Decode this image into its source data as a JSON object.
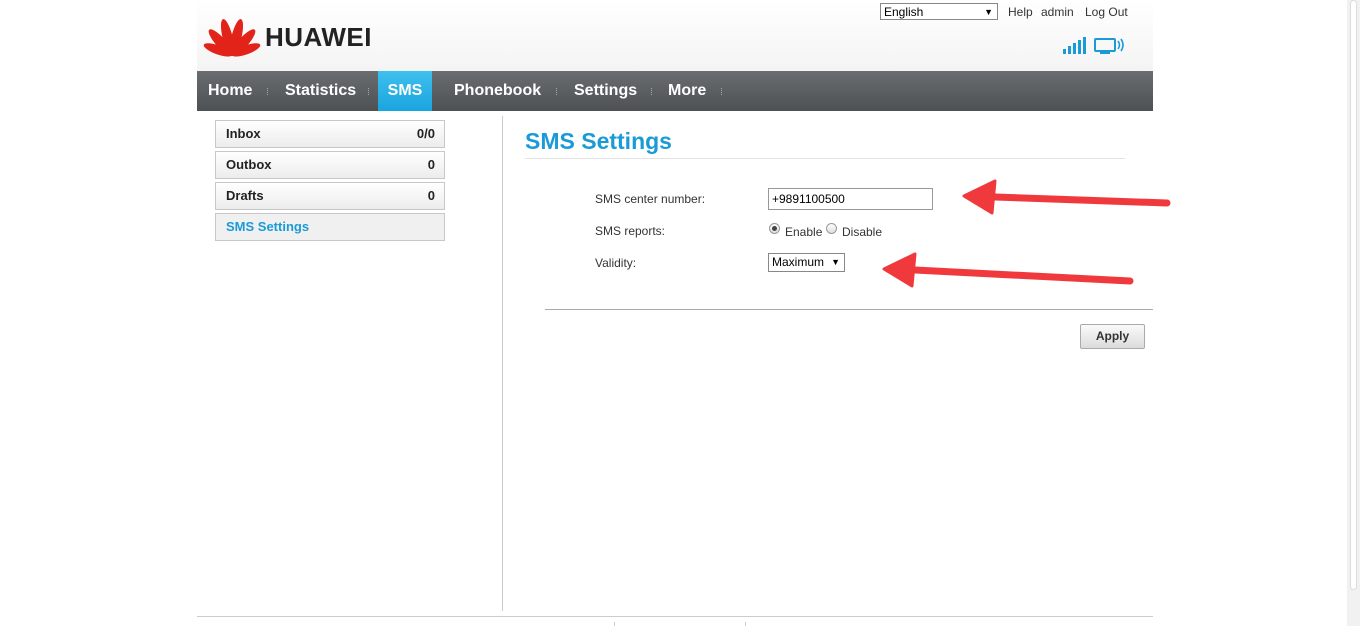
{
  "header": {
    "brand": "HUAWEI",
    "language": "English",
    "links": {
      "help": "Help",
      "user": "admin",
      "logout": "Log Out"
    },
    "colors": {
      "brand_red": "#e2231a",
      "status_blue": "#1a9bd7"
    }
  },
  "nav": {
    "items": [
      {
        "label": "Home"
      },
      {
        "label": "Statistics"
      },
      {
        "label": "SMS",
        "active": true
      },
      {
        "label": "Phonebook"
      },
      {
        "label": "Settings"
      },
      {
        "label": "More"
      }
    ]
  },
  "sidebar": {
    "items": [
      {
        "label": "Inbox",
        "count": "0/0"
      },
      {
        "label": "Outbox",
        "count": "0"
      },
      {
        "label": "Drafts",
        "count": "0"
      },
      {
        "label": "SMS Settings",
        "active": true
      }
    ]
  },
  "main": {
    "title": "SMS Settings",
    "form": {
      "center_number_label": "SMS center number:",
      "center_number_value": "+9891100500",
      "reports_label": "SMS reports:",
      "reports_enable": "Enable",
      "reports_disable": "Disable",
      "reports_selected": "Enable",
      "validity_label": "Validity:",
      "validity_value": "Maximum"
    },
    "apply_label": "Apply"
  },
  "annotations": {
    "arrow_color": "#f0393d"
  }
}
